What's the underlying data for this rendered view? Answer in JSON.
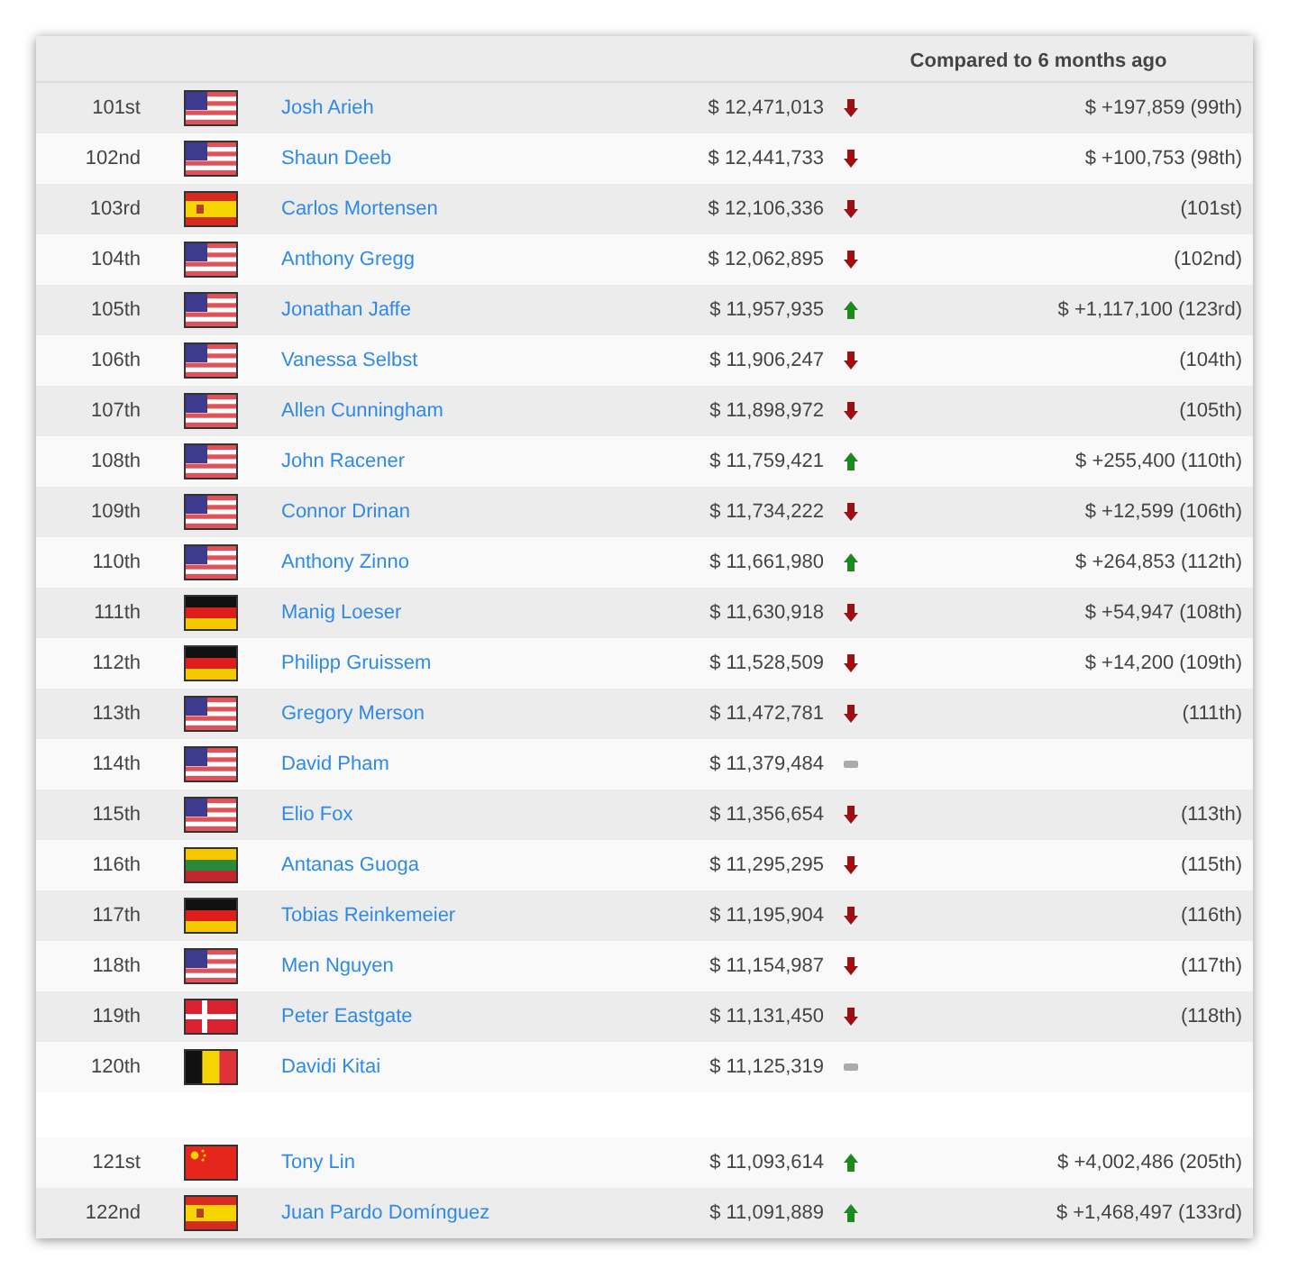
{
  "header": {
    "title": "Compared to 6 months ago"
  },
  "groups": [
    {
      "rows": [
        {
          "rank": "101st",
          "flag": {
            "kind": "us"
          },
          "name": "Josh Arieh",
          "amount": "$ 12,471,013",
          "trend": {
            "kind": "down"
          },
          "change": "$ +197,859 (99th)"
        },
        {
          "rank": "102nd",
          "flag": {
            "kind": "us"
          },
          "name": "Shaun Deeb",
          "amount": "$ 12,441,733",
          "trend": {
            "kind": "down"
          },
          "change": "$ +100,753 (98th)"
        },
        {
          "rank": "103rd",
          "flag": {
            "kind": "es"
          },
          "name": "Carlos Mortensen",
          "amount": "$ 12,106,336",
          "trend": {
            "kind": "down"
          },
          "change": "(101st)"
        },
        {
          "rank": "104th",
          "flag": {
            "kind": "us"
          },
          "name": "Anthony Gregg",
          "amount": "$ 12,062,895",
          "trend": {
            "kind": "down"
          },
          "change": "(102nd)"
        },
        {
          "rank": "105th",
          "flag": {
            "kind": "us"
          },
          "name": "Jonathan Jaffe",
          "amount": "$ 11,957,935",
          "trend": {
            "kind": "up"
          },
          "change": "$ +1,117,100 (123rd)"
        },
        {
          "rank": "106th",
          "flag": {
            "kind": "us"
          },
          "name": "Vanessa Selbst",
          "amount": "$ 11,906,247",
          "trend": {
            "kind": "down"
          },
          "change": "(104th)"
        },
        {
          "rank": "107th",
          "flag": {
            "kind": "us"
          },
          "name": "Allen Cunningham",
          "amount": "$ 11,898,972",
          "trend": {
            "kind": "down"
          },
          "change": "(105th)"
        },
        {
          "rank": "108th",
          "flag": {
            "kind": "us"
          },
          "name": "John Racener",
          "amount": "$ 11,759,421",
          "trend": {
            "kind": "up"
          },
          "change": "$ +255,400 (110th)"
        },
        {
          "rank": "109th",
          "flag": {
            "kind": "us"
          },
          "name": "Connor Drinan",
          "amount": "$ 11,734,222",
          "trend": {
            "kind": "down"
          },
          "change": "$ +12,599 (106th)"
        },
        {
          "rank": "110th",
          "flag": {
            "kind": "us"
          },
          "name": "Anthony Zinno",
          "amount": "$ 11,661,980",
          "trend": {
            "kind": "up"
          },
          "change": "$ +264,853 (112th)"
        },
        {
          "rank": "111th",
          "flag": {
            "kind": "de"
          },
          "name": "Manig Loeser",
          "amount": "$ 11,630,918",
          "trend": {
            "kind": "down"
          },
          "change": "$ +54,947 (108th)"
        },
        {
          "rank": "112th",
          "flag": {
            "kind": "de"
          },
          "name": "Philipp Gruissem",
          "amount": "$ 11,528,509",
          "trend": {
            "kind": "down"
          },
          "change": "$ +14,200 (109th)"
        },
        {
          "rank": "113th",
          "flag": {
            "kind": "us"
          },
          "name": "Gregory Merson",
          "amount": "$ 11,472,781",
          "trend": {
            "kind": "down"
          },
          "change": "(111th)"
        },
        {
          "rank": "114th",
          "flag": {
            "kind": "us"
          },
          "name": "David Pham",
          "amount": "$ 11,379,484",
          "trend": {
            "kind": "same"
          }
        },
        {
          "rank": "115th",
          "flag": {
            "kind": "us"
          },
          "name": "Elio Fox",
          "amount": "$ 11,356,654",
          "trend": {
            "kind": "down"
          },
          "change": "(113th)"
        },
        {
          "rank": "116th",
          "flag": {
            "kind": "lt"
          },
          "name": "Antanas Guoga",
          "amount": "$ 11,295,295",
          "trend": {
            "kind": "down"
          },
          "change": "(115th)"
        },
        {
          "rank": "117th",
          "flag": {
            "kind": "de"
          },
          "name": "Tobias Reinkemeier",
          "amount": "$ 11,195,904",
          "trend": {
            "kind": "down"
          },
          "change": "(116th)"
        },
        {
          "rank": "118th",
          "flag": {
            "kind": "us"
          },
          "name": "Men Nguyen",
          "amount": "$ 11,154,987",
          "trend": {
            "kind": "down"
          },
          "change": "(117th)"
        },
        {
          "rank": "119th",
          "flag": {
            "kind": "dk"
          },
          "name": "Peter Eastgate",
          "amount": "$ 11,131,450",
          "trend": {
            "kind": "down"
          },
          "change": "(118th)"
        },
        {
          "rank": "120th",
          "flag": {
            "kind": "be"
          },
          "name": "Davidi Kitai",
          "amount": "$ 11,125,319",
          "trend": {
            "kind": "same"
          }
        }
      ]
    },
    {
      "rows": [
        {
          "rank": "121st",
          "flag": {
            "kind": "cn"
          },
          "name": "Tony Lin",
          "amount": "$ 11,093,614",
          "trend": {
            "kind": "up"
          },
          "change": "$ +4,002,486 (205th)"
        },
        {
          "rank": "122nd",
          "flag": {
            "kind": "es"
          },
          "name": "Juan Pardo Domínguez",
          "amount": "$ 11,091,889",
          "trend": {
            "kind": "up"
          },
          "change": "$ +1,468,497 (133rd)"
        }
      ]
    }
  ]
}
